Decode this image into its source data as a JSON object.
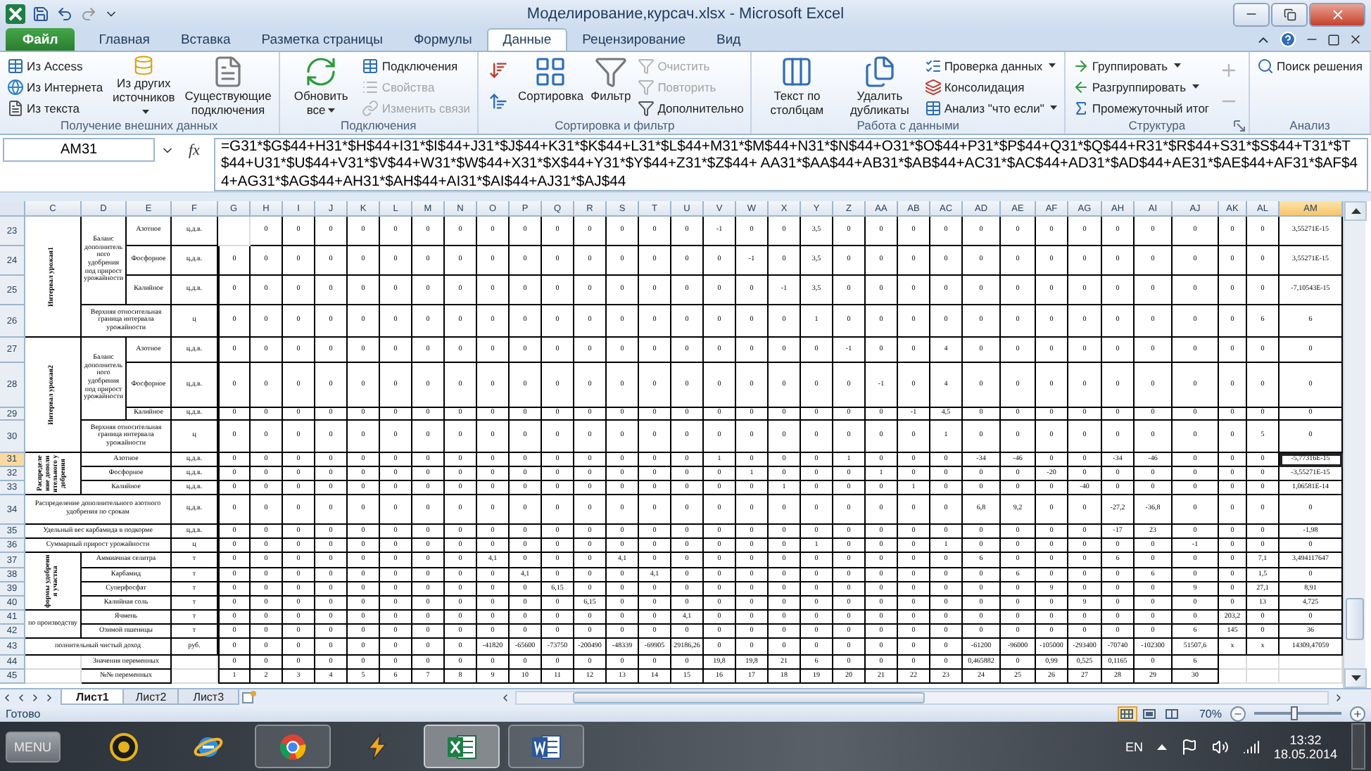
{
  "title_bar": {
    "title": "Моделирование,курсач.xlsx - Microsoft Excel"
  },
  "ribbon_tabs": [
    {
      "label": "Файл",
      "kind": "file",
      "selected": false
    },
    {
      "label": "Главная",
      "kind": "tab",
      "selected": false
    },
    {
      "label": "Вставка",
      "kind": "tab",
      "selected": false
    },
    {
      "label": "Разметка страницы",
      "kind": "tab",
      "selected": false
    },
    {
      "label": "Формулы",
      "kind": "tab",
      "selected": false
    },
    {
      "label": "Данные",
      "kind": "tab",
      "selected": true
    },
    {
      "label": "Рецензирование",
      "kind": "tab",
      "selected": false
    },
    {
      "label": "Вид",
      "kind": "tab",
      "selected": false
    }
  ],
  "ribbon_groups": [
    {
      "label": "Получение внешних данных",
      "columns": [
        {
          "kind": "stack",
          "items": [
            {
              "label": "Из Access",
              "disabled": false,
              "dropdown": false
            },
            {
              "label": "Из Интернета",
              "disabled": false,
              "dropdown": false
            },
            {
              "label": "Из текста",
              "disabled": false,
              "dropdown": false
            }
          ]
        },
        {
          "kind": "large",
          "items": [
            {
              "label": "Из других источников",
              "disabled": false,
              "dropdown": true
            }
          ]
        },
        {
          "kind": "large",
          "items": [
            {
              "label": "Существующие подключения",
              "disabled": false,
              "dropdown": false
            }
          ]
        }
      ]
    },
    {
      "label": "Подключения",
      "columns": [
        {
          "kind": "large",
          "items": [
            {
              "label": "Обновить все",
              "disabled": false,
              "dropdown": true
            }
          ]
        },
        {
          "kind": "stack",
          "items": [
            {
              "label": "Подключения",
              "disabled": false,
              "dropdown": false
            },
            {
              "label": "Свойства",
              "disabled": true,
              "dropdown": false
            },
            {
              "label": "Изменить связи",
              "disabled": true,
              "dropdown": false
            }
          ]
        }
      ]
    },
    {
      "label": "Сортировка и фильтр",
      "columns": [
        {
          "kind": "icons",
          "items": [
            {
              "disabled": false,
              "dropdown": false
            },
            {
              "disabled": false,
              "dropdown": false
            }
          ]
        },
        {
          "kind": "large",
          "items": [
            {
              "label": "Сортировка",
              "disabled": false,
              "dropdown": false
            }
          ]
        },
        {
          "kind": "large",
          "items": [
            {
              "label": "Фильтр",
              "disabled": false,
              "dropdown": false
            }
          ]
        },
        {
          "kind": "stack",
          "items": [
            {
              "label": "Очистить",
              "disabled": true,
              "dropdown": false
            },
            {
              "label": "Повторить",
              "disabled": true,
              "dropdown": false
            },
            {
              "label": "Дополнительно",
              "disabled": false,
              "dropdown": false
            }
          ]
        }
      ]
    },
    {
      "label": "Работа с данными",
      "columns": [
        {
          "kind": "large",
          "items": [
            {
              "label": "Текст по столбцам",
              "disabled": false,
              "dropdown": false
            }
          ]
        },
        {
          "kind": "large",
          "items": [
            {
              "label": "Удалить дубликаты",
              "disabled": false,
              "dropdown": false
            }
          ]
        },
        {
          "kind": "stack",
          "items": [
            {
              "label": "Проверка данных",
              "disabled": false,
              "dropdown": true
            },
            {
              "label": "Консолидация",
              "disabled": false,
              "dropdown": false
            },
            {
              "label": "Анализ \"что если\"",
              "disabled": false,
              "dropdown": true
            }
          ]
        }
      ]
    },
    {
      "label": "Структура",
      "launcher": true,
      "columns": [
        {
          "kind": "stack",
          "items": [
            {
              "label": "Группировать",
              "disabled": false,
              "dropdown": true
            },
            {
              "label": "Разгруппировать",
              "disabled": false,
              "dropdown": true
            },
            {
              "label": "Промежуточный итог",
              "disabled": false,
              "dropdown": false
            }
          ]
        },
        {
          "kind": "icons",
          "items": [
            {
              "disabled": true,
              "dropdown": false
            },
            {
              "disabled": true,
              "dropdown": false
            }
          ]
        }
      ]
    },
    {
      "label": "Анализ",
      "columns": [
        {
          "kind": "stack",
          "items": [
            {
              "label": "Поиск решения",
              "disabled": false,
              "dropdown": false
            }
          ]
        }
      ]
    }
  ],
  "formula_bar": {
    "name_box": "AM31",
    "function_button": "fx",
    "formula": "=G31*$G$44+H31*$H$44+I31*$I$44+J31*$J$44+K31*$K$44+L31*$L$44+M31*$M$44+N31*$N$44+O31*$O$44+P31*$P$44+Q31*$Q$44+R31*$R$44+S31*$S$44+T31*$T$44+U31*$U$44+V31*$V$44+W31*$W$44+X31*$X$44+Y31*$Y$44+Z31*$Z$44+ AA31*$AA$44+AB31*$AB$44+AC31*$AC$44+AD31*$AD$44+AE31*$AE$44+AF31*$AF$44+AG31*$AG$44+AH31*$AH$44+AI31*$AI$44+AJ31*$AJ$44"
  },
  "columns": [
    {
      "label": "C",
      "selected": false
    },
    {
      "label": "D",
      "selected": false
    },
    {
      "label": "E",
      "selected": false
    },
    {
      "label": "F",
      "selected": false
    },
    {
      "label": "G",
      "selected": false
    },
    {
      "label": "H",
      "selected": false
    },
    {
      "label": "I",
      "selected": false
    },
    {
      "label": "J",
      "selected": false
    },
    {
      "label": "K",
      "selected": false
    },
    {
      "label": "L",
      "selected": false
    },
    {
      "label": "M",
      "selected": false
    },
    {
      "label": "N",
      "selected": false
    },
    {
      "label": "O",
      "selected": false
    },
    {
      "label": "P",
      "selected": false
    },
    {
      "label": "Q",
      "selected": false
    },
    {
      "label": "R",
      "selected": false
    },
    {
      "label": "S",
      "selected": false
    },
    {
      "label": "T",
      "selected": false
    },
    {
      "label": "U",
      "selected": false
    },
    {
      "label": "V",
      "selected": false
    },
    {
      "label": "W",
      "selected": false
    },
    {
      "label": "X",
      "selected": false
    },
    {
      "label": "Y",
      "selected": false
    },
    {
      "label": "Z",
      "selected": false
    },
    {
      "label": "AA",
      "selected": false
    },
    {
      "label": "AB",
      "selected": false
    },
    {
      "label": "AC",
      "selected": false
    },
    {
      "label": "AD",
      "selected": false
    },
    {
      "label": "AE",
      "selected": false
    },
    {
      "label": "AF",
      "selected": false
    },
    {
      "label": "AG",
      "selected": false
    },
    {
      "label": "AH",
      "selected": false
    },
    {
      "label": "AI",
      "selected": false
    },
    {
      "label": "AJ",
      "selected": false
    },
    {
      "label": "AK",
      "selected": false
    },
    {
      "label": "AL",
      "selected": false
    },
    {
      "label": "AM",
      "selected": true
    }
  ],
  "rows": [
    {
      "number": "23",
      "selected": false,
      "cells": [
        null,
        "0",
        "0",
        "0",
        "0",
        "0",
        "0",
        "0",
        "0",
        "0",
        "0",
        "0",
        "0",
        "0",
        "0",
        "-1",
        "0",
        "0",
        "3,5",
        "0",
        "0",
        "0",
        "0",
        "0",
        "0",
        "0",
        "0",
        "0",
        "0",
        "0",
        "0",
        "0",
        "3,55271E-15"
      ]
    },
    {
      "number": "24",
      "selected": false,
      "cells": [
        "0",
        "0",
        "0",
        "0",
        "0",
        "0",
        "0",
        "0",
        "0",
        "0",
        "0",
        "0",
        "0",
        "0",
        "0",
        "0",
        "-1",
        "0",
        "3,5",
        "0",
        "0",
        "0",
        "0",
        "0",
        "0",
        "0",
        "0",
        "0",
        "0",
        "0",
        "0",
        "0",
        "3,55271E-15"
      ]
    },
    {
      "number": "25",
      "selected": false,
      "cells": [
        "0",
        "0",
        "0",
        "0",
        "0",
        "0",
        "0",
        "0",
        "0",
        "0",
        "0",
        "0",
        "0",
        "0",
        "0",
        "0",
        "0",
        "-1",
        "3,5",
        "0",
        "0",
        "0",
        "0",
        "0",
        "0",
        "0",
        "0",
        "0",
        "0",
        "0",
        "0",
        "0",
        "-7,10543E-15"
      ]
    },
    {
      "number": "26",
      "selected": false,
      "cells": [
        "0",
        "0",
        "0",
        "0",
        "0",
        "0",
        "0",
        "0",
        "0",
        "0",
        "0",
        "0",
        "0",
        "0",
        "0",
        "0",
        "0",
        "0",
        "1",
        "0",
        "0",
        "0",
        "0",
        "0",
        "0",
        "0",
        "0",
        "0",
        "0",
        "0",
        "0",
        "6",
        "6"
      ]
    },
    {
      "number": "27",
      "selected": false,
      "cells": [
        "0",
        "0",
        "0",
        "0",
        "0",
        "0",
        "0",
        "0",
        "0",
        "0",
        "0",
        "0",
        "0",
        "0",
        "0",
        "0",
        "0",
        "0",
        "0",
        "-1",
        "0",
        "0",
        "4",
        "0",
        "0",
        "0",
        "0",
        "0",
        "0",
        "0",
        "0",
        "0",
        "0"
      ]
    },
    {
      "number": "28",
      "selected": false,
      "cells": [
        "0",
        "0",
        "0",
        "0",
        "0",
        "0",
        "0",
        "0",
        "0",
        "0",
        "0",
        "0",
        "0",
        "0",
        "0",
        "0",
        "0",
        "0",
        "0",
        "0",
        "-1",
        "0",
        "4",
        "0",
        "0",
        "0",
        "0",
        "0",
        "0",
        "0",
        "0",
        "0",
        "0"
      ]
    },
    {
      "number": "29",
      "selected": false,
      "cells": [
        "0",
        "0",
        "0",
        "0",
        "0",
        "0",
        "0",
        "0",
        "0",
        "0",
        "0",
        "0",
        "0",
        "0",
        "0",
        "0",
        "0",
        "0",
        "0",
        "0",
        "0",
        "-1",
        "4,5",
        "0",
        "0",
        "0",
        "0",
        "0",
        "0",
        "0",
        "0",
        "0",
        "0"
      ]
    },
    {
      "number": "30",
      "selected": false,
      "cells": [
        "0",
        "0",
        "0",
        "0",
        "0",
        "0",
        "0",
        "0",
        "0",
        "0",
        "0",
        "0",
        "0",
        "0",
        "0",
        "0",
        "0",
        "0",
        "0",
        "0",
        "0",
        "0",
        "1",
        "0",
        "0",
        "0",
        "0",
        "0",
        "0",
        "0",
        "0",
        "5",
        "0"
      ]
    },
    {
      "number": "31",
      "selected": true,
      "cells": [
        "0",
        "0",
        "0",
        "0",
        "0",
        "0",
        "0",
        "0",
        "0",
        "0",
        "0",
        "0",
        "0",
        "0",
        "0",
        "1",
        "0",
        "0",
        "0",
        "1",
        "0",
        "0",
        "0",
        "-34",
        "-46",
        "0",
        "0",
        "-34",
        "-46",
        "0",
        "0",
        "0",
        "-5,77316E-15"
      ]
    },
    {
      "number": "32",
      "selected": false,
      "cells": [
        "0",
        "0",
        "0",
        "0",
        "0",
        "0",
        "0",
        "0",
        "0",
        "0",
        "0",
        "0",
        "0",
        "0",
        "0",
        "0",
        "1",
        "0",
        "0",
        "0",
        "1",
        "0",
        "0",
        "0",
        "0",
        "-20",
        "0",
        "0",
        "0",
        "0",
        "0",
        "0",
        "-3,55271E-15"
      ]
    },
    {
      "number": "33",
      "selected": false,
      "cells": [
        "0",
        "0",
        "0",
        "0",
        "0",
        "0",
        "0",
        "0",
        "0",
        "0",
        "0",
        "0",
        "0",
        "0",
        "0",
        "0",
        "0",
        "1",
        "0",
        "0",
        "0",
        "1",
        "0",
        "0",
        "0",
        "0",
        "-40",
        "0",
        "0",
        "0",
        "0",
        "0",
        "1,06581E-14"
      ]
    },
    {
      "number": "34",
      "selected": false,
      "cells": [
        "0",
        "0",
        "0",
        "0",
        "0",
        "0",
        "0",
        "0",
        "0",
        "0",
        "0",
        "0",
        "0",
        "0",
        "0",
        "0",
        "0",
        "0",
        "0",
        "0",
        "0",
        "0",
        "0",
        "6,8",
        "9,2",
        "0",
        "0",
        "-27,2",
        "-36,8",
        "0",
        "0",
        "0",
        "0"
      ]
    },
    {
      "number": "35",
      "selected": false,
      "cells": [
        "0",
        "0",
        "0",
        "0",
        "0",
        "0",
        "0",
        "0",
        "0",
        "0",
        "0",
        "0",
        "0",
        "0",
        "0",
        "0",
        "0",
        "0",
        "0",
        "0",
        "0",
        "0",
        "0",
        "0",
        "0",
        "0",
        "0",
        "-17",
        "23",
        "0",
        "0",
        "0",
        "-1,98"
      ]
    },
    {
      "number": "36",
      "selected": false,
      "cells": [
        "0",
        "0",
        "0",
        "0",
        "0",
        "0",
        "0",
        "0",
        "0",
        "0",
        "0",
        "0",
        "0",
        "0",
        "0",
        "0",
        "0",
        "0",
        "1",
        "0",
        "0",
        "0",
        "1",
        "0",
        "0",
        "0",
        "0",
        "0",
        "0",
        "-1",
        "0",
        "0",
        "0"
      ]
    },
    {
      "number": "37",
      "selected": false,
      "cells": [
        "0",
        "0",
        "0",
        "0",
        "0",
        "0",
        "0",
        "0",
        "4,1",
        "0",
        "0",
        "0",
        "4,1",
        "0",
        "0",
        "0",
        "0",
        "0",
        "0",
        "0",
        "0",
        "0",
        "0",
        "6",
        "0",
        "0",
        "0",
        "6",
        "0",
        "0",
        "0",
        "7,1",
        "3,494117647"
      ]
    },
    {
      "number": "38",
      "selected": false,
      "cells": [
        "0",
        "0",
        "0",
        "0",
        "0",
        "0",
        "0",
        "0",
        "0",
        "4,1",
        "0",
        "0",
        "0",
        "4,1",
        "0",
        "0",
        "0",
        "0",
        "0",
        "0",
        "0",
        "0",
        "0",
        "0",
        "6",
        "0",
        "0",
        "0",
        "6",
        "0",
        "0",
        "1,5",
        "0"
      ]
    },
    {
      "number": "39",
      "selected": false,
      "cells": [
        "0",
        "0",
        "0",
        "0",
        "0",
        "0",
        "0",
        "0",
        "0",
        "0",
        "6,15",
        "0",
        "0",
        "0",
        "0",
        "0",
        "0",
        "0",
        "0",
        "0",
        "0",
        "0",
        "0",
        "0",
        "0",
        "9",
        "0",
        "0",
        "0",
        "9",
        "0",
        "27,1",
        "8,91"
      ]
    },
    {
      "number": "40",
      "selected": false,
      "cells": [
        "0",
        "0",
        "0",
        "0",
        "0",
        "0",
        "0",
        "0",
        "0",
        "0",
        "0",
        "6,15",
        "0",
        "0",
        "0",
        "0",
        "0",
        "0",
        "0",
        "0",
        "0",
        "0",
        "0",
        "0",
        "0",
        "0",
        "9",
        "0",
        "0",
        "0",
        "0",
        "13",
        "4,725"
      ]
    },
    {
      "number": "41",
      "selected": false,
      "cells": [
        "0",
        "0",
        "0",
        "0",
        "0",
        "0",
        "0",
        "0",
        "0",
        "0",
        "0",
        "0",
        "0",
        "0",
        "4,1",
        "0",
        "0",
        "0",
        "0",
        "0",
        "0",
        "0",
        "0",
        "0",
        "0",
        "0",
        "0",
        "0",
        "0",
        "0",
        "203,2",
        "0",
        "0"
      ]
    },
    {
      "number": "42",
      "selected": false,
      "cells": [
        "0",
        "0",
        "0",
        "0",
        "0",
        "0",
        "0",
        "0",
        "0",
        "0",
        "0",
        "0",
        "0",
        "0",
        "0",
        "0",
        "0",
        "0",
        "0",
        "0",
        "0",
        "0",
        "0",
        "0",
        "0",
        "0",
        "0",
        "0",
        "0",
        "6",
        "145",
        "0",
        "36"
      ]
    },
    {
      "number": "43",
      "selected": false,
      "cells": [
        "0",
        "0",
        "0",
        "0",
        "0",
        "0",
        "0",
        "0",
        "-41820",
        "-65600",
        "-73750",
        "-200490",
        "-48339",
        "-69905",
        "29186,26",
        "0",
        "0",
        "0",
        "0",
        "0",
        "0",
        "0",
        "0",
        "-61200",
        "-96000",
        "-105000",
        "-293400",
        "-70740",
        "-102300",
        "51507,6",
        "x",
        "x",
        "14309,47059"
      ]
    },
    {
      "number": "44",
      "selected": false,
      "cells": [
        "0",
        "0",
        "0",
        "0",
        "0",
        "0",
        "0",
        "0",
        "0",
        "0",
        "0",
        "0",
        "0",
        "0",
        "0",
        "19,8",
        "19,8",
        "21",
        "6",
        "0",
        "0",
        "0",
        "0",
        "0,465882",
        "0",
        "0,99",
        "0,525",
        "0,1165",
        "0",
        "6",
        null,
        null,
        null
      ]
    },
    {
      "number": "45",
      "selected": false,
      "cells": [
        "1",
        "2",
        "3",
        "4",
        "5",
        "6",
        "7",
        "8",
        "9",
        "10",
        "11",
        "12",
        "13",
        "14",
        "15",
        "16",
        "17",
        "18",
        "19",
        "20",
        "21",
        "22",
        "23",
        "24",
        "25",
        "26",
        "27",
        "28",
        "29",
        "30",
        null,
        null,
        null
      ]
    }
  ],
  "labels": [
    {
      "text": "Интервал урожая1",
      "kind": "vertical"
    },
    {
      "text": "Баланс дополнительного удобрения под прирост урожайности",
      "kind": "text"
    },
    {
      "text": "Азотное",
      "kind": "text"
    },
    {
      "text": "ц.д.в.",
      "kind": "text"
    },
    {
      "text": "Фосфорное",
      "kind": "text"
    },
    {
      "text": "ц.д.в.",
      "kind": "text"
    },
    {
      "text": "Калийное",
      "kind": "text"
    },
    {
      "text": "ц.д.в.",
      "kind": "text"
    },
    {
      "text": "Верхняя относительная граница интервала урожайности",
      "kind": "text"
    },
    {
      "text": "ц",
      "kind": "text"
    },
    {
      "text": "Интервал урожая2",
      "kind": "vertical"
    },
    {
      "text": "Баланс дополнительного удобрения под прирост урожайности",
      "kind": "text"
    },
    {
      "text": "Азотное",
      "kind": "text"
    },
    {
      "text": "ц.д.в.",
      "kind": "text"
    },
    {
      "text": "Фосфорное",
      "kind": "text"
    },
    {
      "text": "ц.д.в.",
      "kind": "text"
    },
    {
      "text": "Калийное",
      "kind": "text"
    },
    {
      "text": "ц.д.в.",
      "kind": "text"
    },
    {
      "text": "Верхняя относительная граница интервала урожайности",
      "kind": "text"
    },
    {
      "text": "ц",
      "kind": "text"
    },
    {
      "text": "Распределение дополнительного удобрения",
      "kind": "vertical"
    },
    {
      "text": "Азотное",
      "kind": "text"
    },
    {
      "text": "ц.д.в.",
      "kind": "text"
    },
    {
      "text": "Фосфорное",
      "kind": "text"
    },
    {
      "text": "ц.д.в.",
      "kind": "text"
    },
    {
      "text": "Калийное",
      "kind": "text"
    },
    {
      "text": "ц.д.в.",
      "kind": "text"
    },
    {
      "text": "Распределение дополнительного азотного удобрения по срокам",
      "kind": "text"
    },
    {
      "text": "ц.д.в.",
      "kind": "text"
    },
    {
      "text": "Удельный вес карбамида в подкорме",
      "kind": "text"
    },
    {
      "text": "ц.д.в.",
      "kind": "text"
    },
    {
      "text": "Суммарный прирост урожайности",
      "kind": "text"
    },
    {
      "text": "ц",
      "kind": "text"
    },
    {
      "text": "формы удобрения участка",
      "kind": "vertical"
    },
    {
      "text": "Аммиачная селитра",
      "kind": "text"
    },
    {
      "text": "т",
      "kind": "text"
    },
    {
      "text": "Карбамид",
      "kind": "text"
    },
    {
      "text": "т",
      "kind": "text"
    },
    {
      "text": "Суперфосфат",
      "kind": "text"
    },
    {
      "text": "т",
      "kind": "text"
    },
    {
      "text": "Калийная соль",
      "kind": "text"
    },
    {
      "text": "т",
      "kind": "text"
    },
    {
      "text": "по производству",
      "kind": "text"
    },
    {
      "text": "Ячмень",
      "kind": "text"
    },
    {
      "text": "т",
      "kind": "text"
    },
    {
      "text": "Озимой пшеницы",
      "kind": "text"
    },
    {
      "text": "т",
      "kind": "text"
    },
    {
      "text": "полнительный чистый доход",
      "kind": "text"
    },
    {
      "text": "руб.",
      "kind": "text"
    },
    {
      "text": "Значения переменных",
      "kind": "text"
    },
    {
      "text": "№№ переменных",
      "kind": "text"
    }
  ],
  "sheet_tabs": [
    {
      "label": "Лист1",
      "selected": true
    },
    {
      "label": "Лист2",
      "selected": false
    },
    {
      "label": "Лист3",
      "selected": false
    }
  ],
  "status_bar": {
    "text": "Готово",
    "views": [
      {
        "selected": true
      },
      {
        "selected": false
      },
      {
        "selected": false
      }
    ],
    "zoom": "70%",
    "level": 0.45
  },
  "taskbar": {
    "start_label": "MENU",
    "apps": [
      {
        "kind": "disc",
        "open": false,
        "selected": false
      },
      {
        "kind": "globe",
        "open": false,
        "selected": false
      },
      {
        "kind": "wheel",
        "open": true,
        "selected": false
      },
      {
        "kind": "lightning",
        "open": false,
        "selected": false
      },
      {
        "kind": "spreadsheet",
        "open": true,
        "selected": true
      },
      {
        "kind": "document",
        "open": true,
        "selected": false
      }
    ],
    "language": "EN",
    "time": "13:32",
    "date": "18.05.2014"
  }
}
